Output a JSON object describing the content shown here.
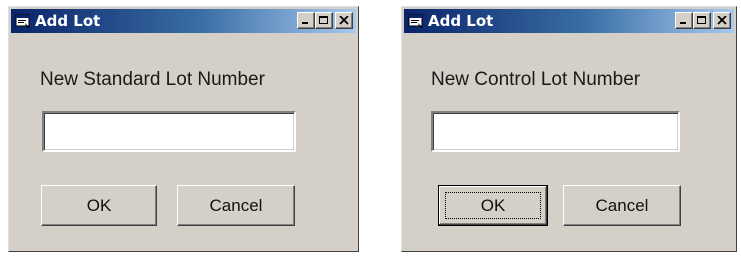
{
  "colors": {
    "face": "#d4d0c8",
    "title_start": "#0a246a",
    "title_end": "#a6caf0",
    "title_text": "#ffffff"
  },
  "dialogs": [
    {
      "title": "Add Lot",
      "icon": "app-window-icon",
      "prompt": "New Standard Lot Number",
      "input_value": "",
      "ok_label": "OK",
      "cancel_label": "Cancel",
      "titlebar_buttons": [
        "minimize-icon",
        "maximize-icon",
        "close-icon"
      ]
    },
    {
      "title": "Add Lot",
      "icon": "app-window-icon",
      "prompt": "New Control Lot Number",
      "input_value": "",
      "ok_label": "OK",
      "cancel_label": "Cancel",
      "ok_focused": true,
      "titlebar_buttons": [
        "minimize-icon",
        "maximize-icon",
        "close-icon"
      ]
    }
  ]
}
